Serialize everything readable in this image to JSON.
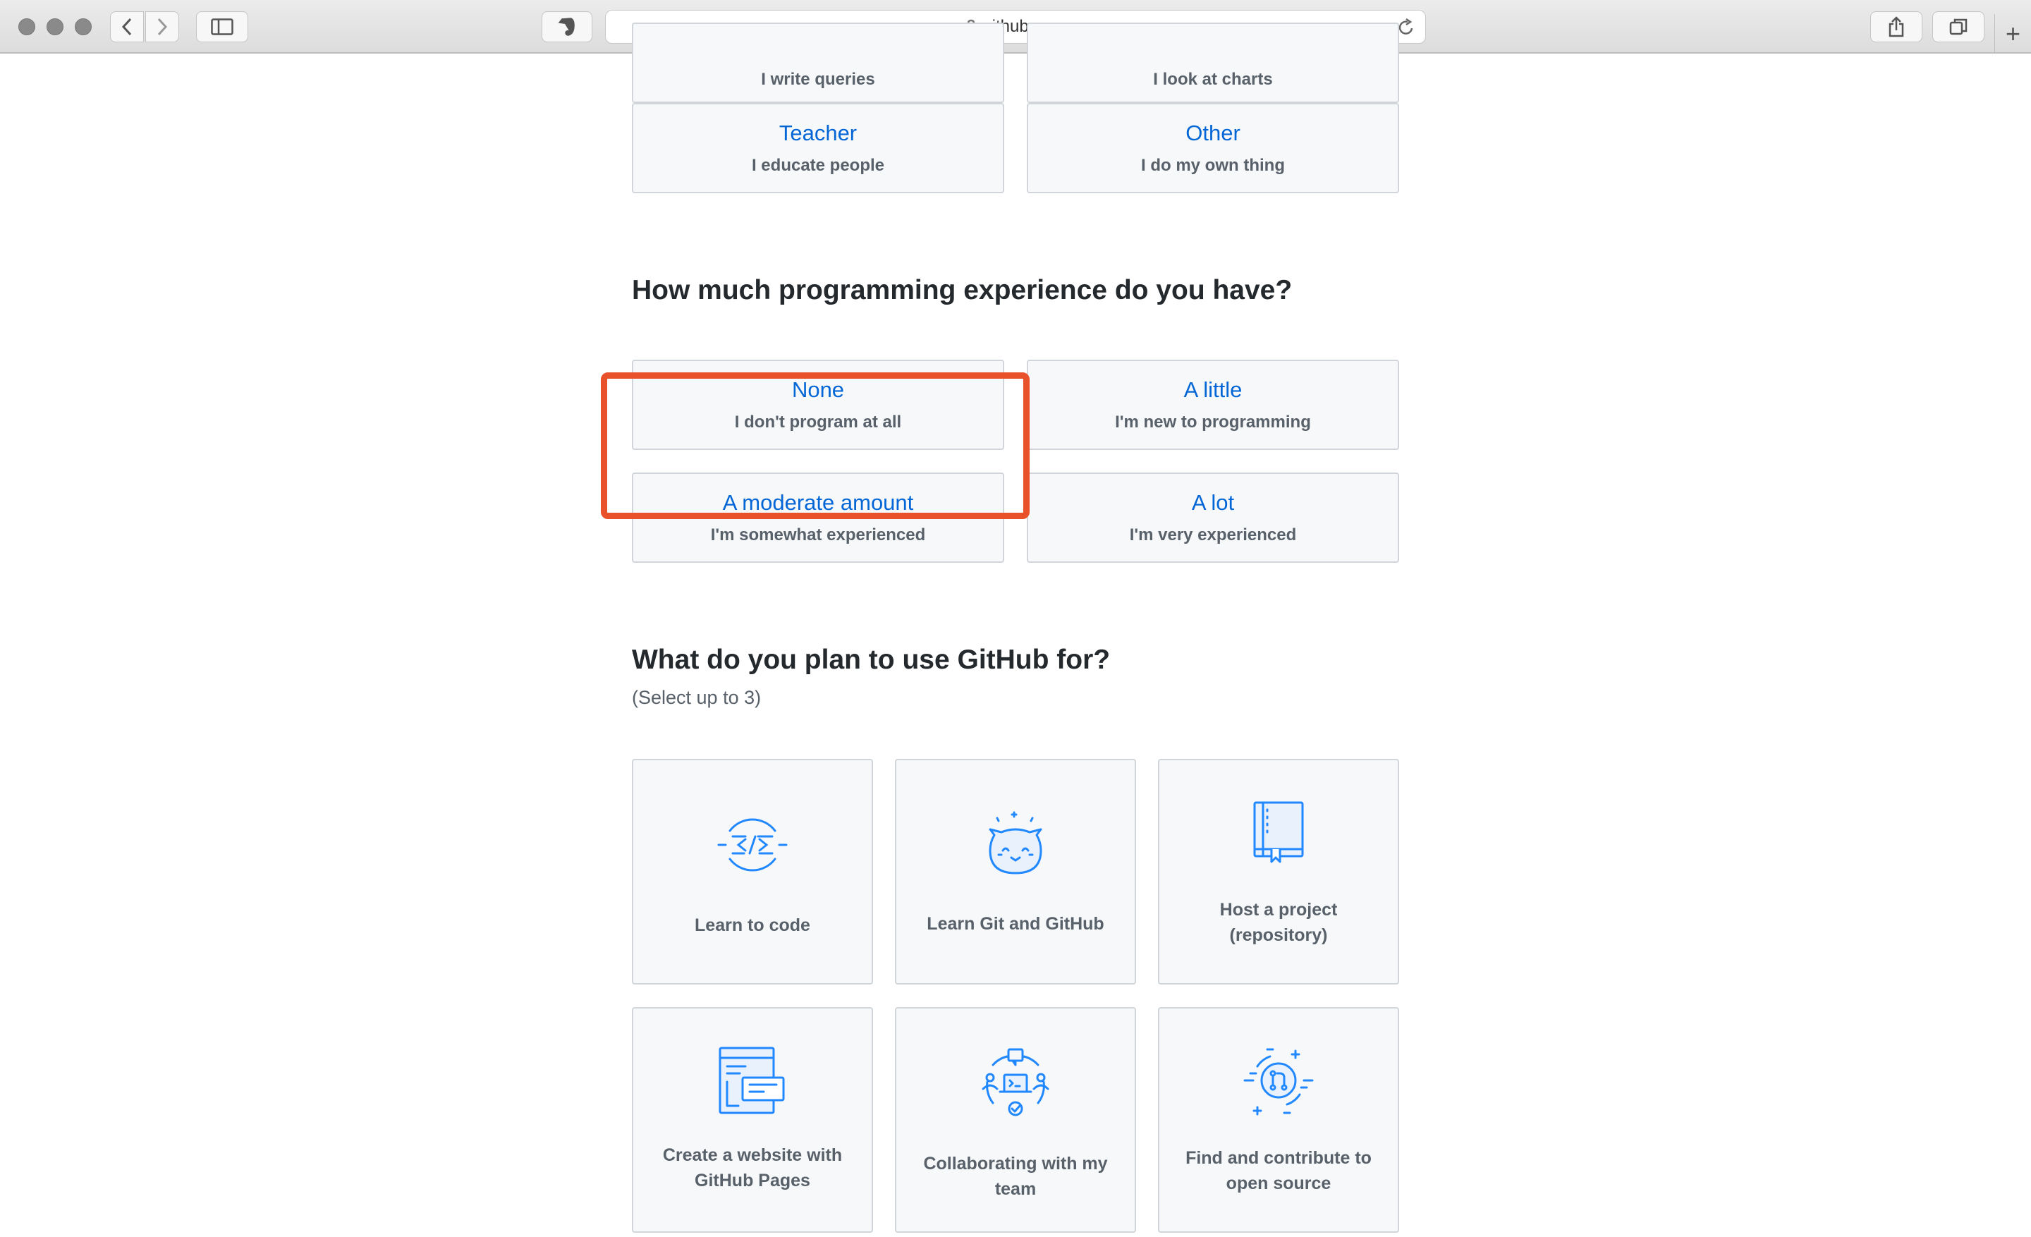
{
  "browser": {
    "url": "github.com"
  },
  "role_options_partial": [
    {
      "subtitle": "I write queries"
    },
    {
      "subtitle": "I look at charts"
    }
  ],
  "role_options": [
    {
      "title": "Teacher",
      "subtitle": "I educate people"
    },
    {
      "title": "Other",
      "subtitle": "I do my own thing"
    }
  ],
  "experience": {
    "heading": "How much programming experience do you have?",
    "options": [
      {
        "title": "None",
        "subtitle": "I don't program at all"
      },
      {
        "title": "A little",
        "subtitle": "I'm new to programming"
      },
      {
        "title": "A moderate amount",
        "subtitle": "I'm somewhat experienced"
      },
      {
        "title": "A lot",
        "subtitle": "I'm very experienced"
      }
    ],
    "highlight_color": "#e8512a"
  },
  "usage": {
    "heading": "What do you plan to use GitHub for?",
    "note": "(Select up to 3)",
    "options": [
      {
        "label": "Learn to code",
        "icon": "code-icon"
      },
      {
        "label": "Learn Git and GitHub",
        "icon": "octocat-icon"
      },
      {
        "label": "Host a project (repository)",
        "icon": "repository-book-icon"
      },
      {
        "label": "Create a website with GitHub Pages",
        "icon": "website-pages-icon"
      },
      {
        "label": "Collaborating with my team",
        "icon": "team-collaboration-icon"
      },
      {
        "label": "Find and contribute to open source",
        "icon": "open-source-pull-request-icon"
      }
    ]
  },
  "colors": {
    "link_blue": "#0366d6",
    "icon_blue": "#2188ff",
    "card_bg": "#f6f8fa",
    "card_border": "#d1d5da"
  }
}
